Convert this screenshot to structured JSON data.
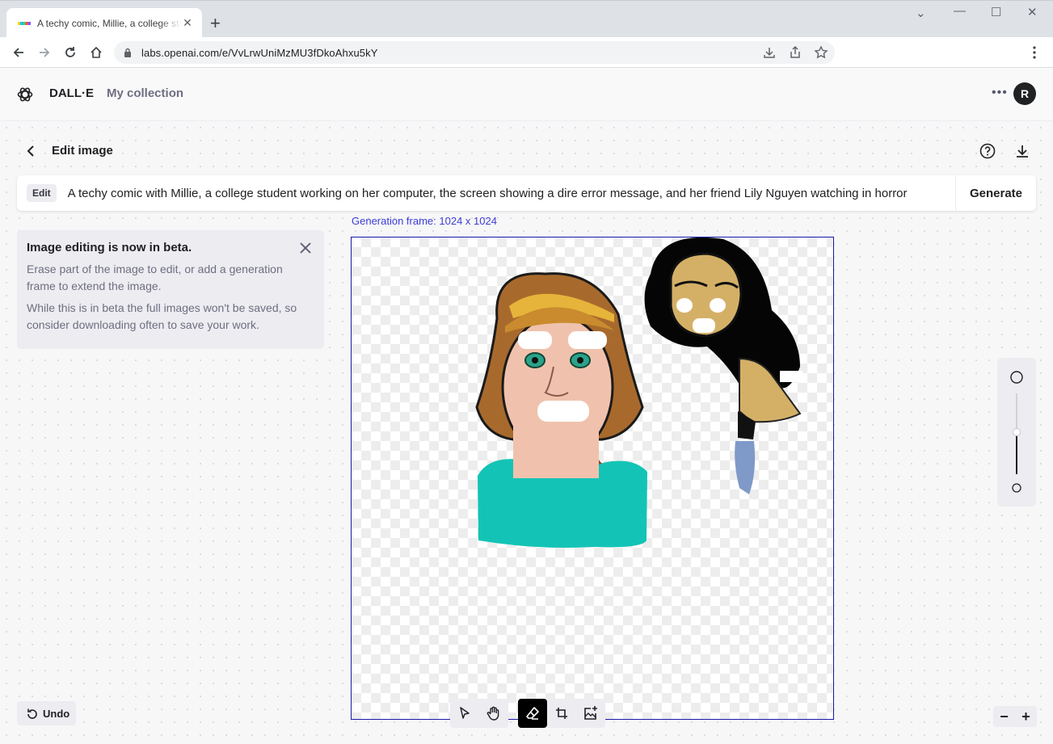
{
  "browser": {
    "tab_title": "A techy comic, Millie, a college student",
    "url": "labs.openai.com/e/VvLrwUniMzMU3fDkoAhxu5kY"
  },
  "header": {
    "brand": "DALL·E",
    "collection": "My collection",
    "avatar_initial": "R"
  },
  "editor": {
    "title": "Edit image",
    "edit_badge": "Edit",
    "prompt": "A techy comic with Millie, a college student working on her computer, the screen showing a dire error message, and her friend Lily Nguyen watching in horror",
    "generate_label": "Generate",
    "frame_label": "Generation frame: 1024 x 1024"
  },
  "beta_notice": {
    "title": "Image editing is now in beta.",
    "line1": "Erase part of the image to edit, or add a generation frame to extend the image.",
    "line2": "While this is in beta the full images won't be saved, so consider downloading often to save your work."
  },
  "undo_label": "Undo",
  "zoom": {
    "out_label": "−",
    "in_label": "+"
  },
  "tools": [
    "select-tool",
    "pan-tool",
    "eraser-tool",
    "add-frame-tool",
    "upload-image-tool"
  ],
  "active_tool": "eraser-tool",
  "colors": {
    "frame_border": "#1a1aa8",
    "frame_label": "#3c3cd8",
    "accent_dark": "#202123"
  }
}
